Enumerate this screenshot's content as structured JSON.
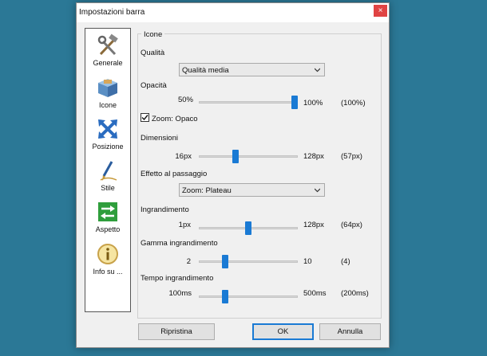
{
  "window": {
    "title": "Impostazioni barra",
    "close_glyph": "×"
  },
  "sidebar": {
    "items": [
      {
        "label": "Generale",
        "icon": "tools-icon"
      },
      {
        "label": "Icone",
        "icon": "box-icon"
      },
      {
        "label": "Posizione",
        "icon": "move-arrows-icon"
      },
      {
        "label": "Stile",
        "icon": "pen-icon"
      },
      {
        "label": "Aspetto",
        "icon": "swap-arrows-icon"
      },
      {
        "label": "Info su ...",
        "icon": "info-icon"
      }
    ]
  },
  "group": {
    "legend": "Icone"
  },
  "quality": {
    "label": "Qualità",
    "selected": "Qualità media"
  },
  "opacity": {
    "label": "Opacità",
    "min": "50%",
    "max": "100%",
    "current": "(100%)",
    "value_fraction": 1.0
  },
  "zoom_opaque": {
    "label": "Zoom: Opaco",
    "checked": true
  },
  "dimensions": {
    "label": "Dimensioni",
    "min": "16px",
    "max": "128px",
    "current": "(57px)",
    "value_fraction": 0.366
  },
  "hover_effect": {
    "label": "Effetto al passaggio",
    "selected": "Zoom: Plateau"
  },
  "magnification": {
    "label": "Ingrandimento",
    "min": "1px",
    "max": "128px",
    "current": "(64px)",
    "value_fraction": 0.496
  },
  "mag_range": {
    "label": "Gamma ingrandimento",
    "min": "2",
    "max": "10",
    "current": "(4)",
    "value_fraction": 0.25
  },
  "mag_time": {
    "label": "Tempo ingrandimento",
    "min": "100ms",
    "max": "500ms",
    "current": "(200ms)",
    "value_fraction": 0.25
  },
  "buttons": {
    "reset": "Ripristina",
    "ok": "OK",
    "cancel": "Annulla"
  },
  "colors": {
    "accent": "#1a7ad4",
    "desktop": "#2b7896",
    "close": "#e04343"
  }
}
